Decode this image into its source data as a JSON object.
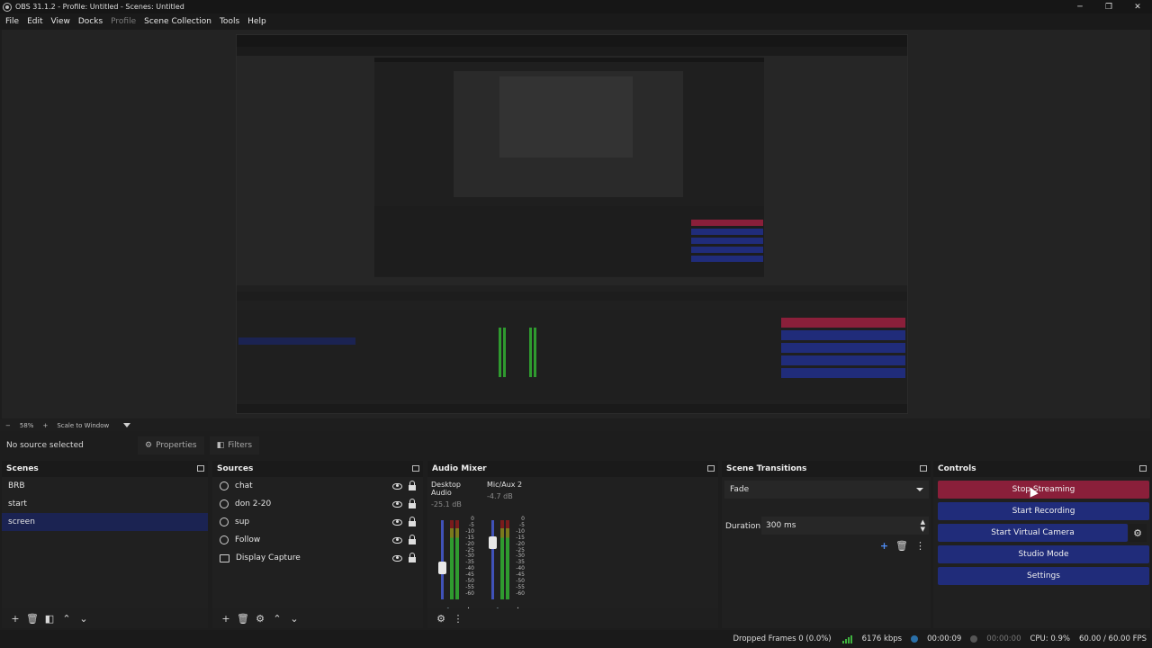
{
  "window": {
    "title": "OBS 31.1.2 - Profile: Untitled - Scenes: Untitled",
    "minimize": "─",
    "maximize": "❐",
    "close": "✕"
  },
  "menu": [
    "File",
    "Edit",
    "View",
    "Docks",
    "Profile",
    "Scene Collection",
    "Tools",
    "Help"
  ],
  "zoom": {
    "minus": "−",
    "value": "58%",
    "plus": "+",
    "mode": "Scale to Window"
  },
  "context": {
    "selection": "No source selected",
    "properties": "Properties",
    "filters": "Filters"
  },
  "scenes": {
    "title": "Scenes",
    "items": [
      "BRB",
      "start",
      "screen"
    ],
    "selected": "screen"
  },
  "sources": {
    "title": "Sources",
    "items": [
      {
        "name": "chat",
        "icon": "browser-icon"
      },
      {
        "name": "don 2-20",
        "icon": "browser-icon"
      },
      {
        "name": "sup",
        "icon": "browser-icon"
      },
      {
        "name": "Follow",
        "icon": "browser-icon"
      },
      {
        "name": "Display Capture",
        "icon": "display-icon"
      }
    ]
  },
  "audio": {
    "title": "Audio Mixer",
    "scale": [
      "0",
      "-5",
      "-10",
      "-15",
      "-20",
      "-25",
      "-30",
      "-35",
      "-40",
      "-45",
      "-50",
      "-55",
      "-60"
    ],
    "channels": [
      {
        "name": "Desktop Audio",
        "db": "-25.1 dB"
      },
      {
        "name": "Mic/Aux 2",
        "db": "-4.7 dB"
      }
    ]
  },
  "transitions": {
    "title": "Scene Transitions",
    "selected": "Fade",
    "duration_label": "Duration",
    "duration_value": "300 ms"
  },
  "controls": {
    "title": "Controls",
    "stop_streaming": "Stop Streaming",
    "start_recording": "Start Recording",
    "start_virtual_camera": "Start Virtual Camera",
    "studio_mode": "Studio Mode",
    "settings": "Settings"
  },
  "status": {
    "dropped_frames": "Dropped Frames 0 (0.0%)",
    "bitrate": "6176 kbps",
    "stream_time": "00:00:09",
    "record_time": "00:00:00",
    "cpu": "CPU: 0.9%",
    "fps": "60.00 / 60.00 FPS"
  },
  "colors": {
    "stop_streaming": "#8a1f3a",
    "control_button": "#202c7a",
    "selected_scene": "#1b2352"
  }
}
